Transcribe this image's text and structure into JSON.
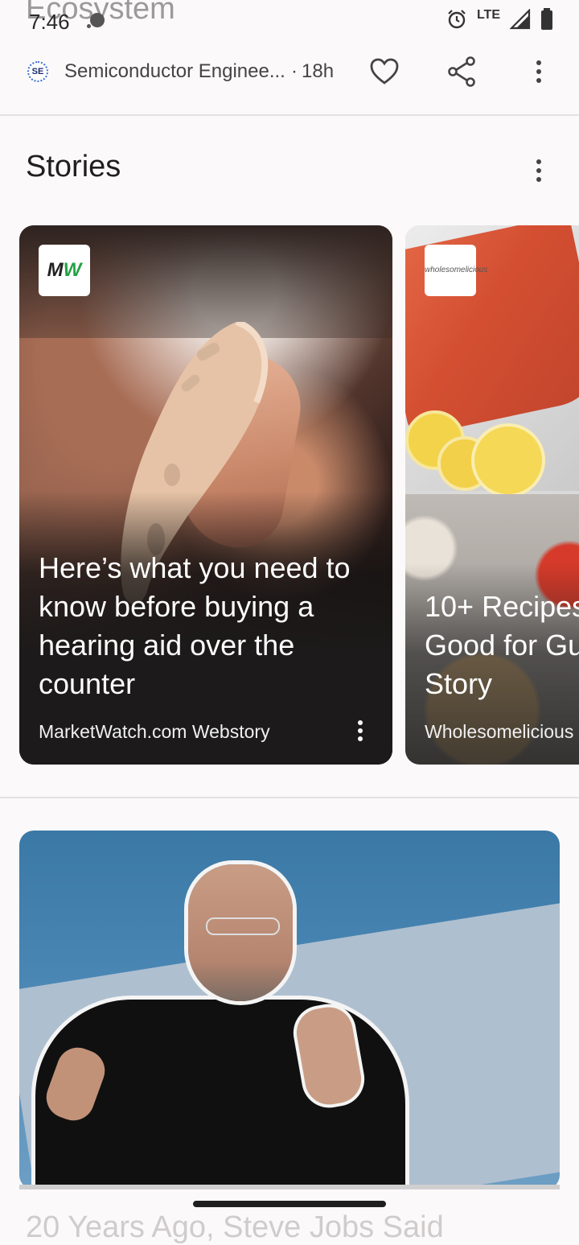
{
  "background_article": {
    "title_fragment": "Ecosystem",
    "next_title_fragment": "20 Years Ago, Steve Jobs Said"
  },
  "status_bar": {
    "time": "7:46",
    "network": "LTE",
    "icons": [
      "alarm-icon",
      "signal-icon",
      "battery-icon"
    ]
  },
  "source_header": {
    "publisher": "Semiconductor Enginee...",
    "separator": "·",
    "age": "18h",
    "logo_text": "SE",
    "actions": [
      "heart-icon",
      "share-icon",
      "more-vert-icon"
    ]
  },
  "stories": {
    "heading": "Stories",
    "cards": [
      {
        "logo_text_1": "M",
        "logo_text_2": "W",
        "title": "Here’s what you need to know before buying a hearing aid over the counter",
        "source": "MarketWatch.com Webstory"
      },
      {
        "logo_text": "wholesomelicious",
        "title_line1": "10+ Recipes",
        "title_line2": "Good for Gu",
        "title_line3": "Story",
        "source": "Wholesomelicious"
      }
    ]
  },
  "colors": {
    "background": "#fcf9fb",
    "text_primary": "#1f1f1f",
    "divider": "#e4e1e3",
    "mw_green": "#25a243"
  }
}
